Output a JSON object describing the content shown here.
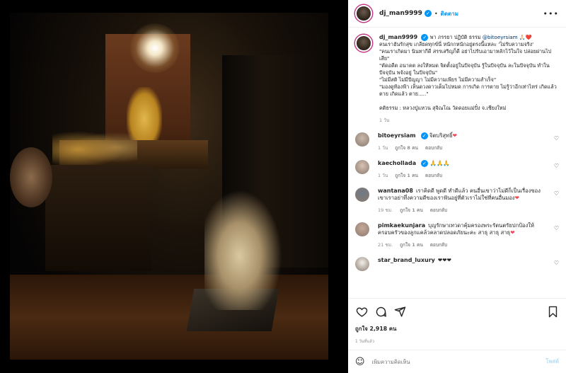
{
  "header": {
    "username": "dj_man9999",
    "separator": "•",
    "follow_label": "ติดตาม",
    "more_icon": "more-horizontal-icon"
  },
  "caption": {
    "username": "dj_man9999",
    "mention_prefix": "พา ภรรยา ปฏิบัติ ธรรม ",
    "mention": "@bitoeyrsiam",
    "mention_suffix": " 🙏🏻❤️",
    "text": "คนเราฮันรักสุข เกลียดทุกข์นี่ หนักกหนักอยู่ตรงนี้แหละ 'ไม่รับความจริง'\n\"คนเราเกิดมา นินทากีดี สรรเสริญก็ดี อย่าไปรับเอามาหลักไว้ในใจ ปล่อยผ่านไปเสีย\"\n\"ตัดอดีต อนาคต ลงให้หมด จิตตั้งอยู่ในปัจจุบัน รู้ในปัจจุบัน ละในปัจจุบัน ทำในปัจจุบัน พจังอยู่ ในปัจจุบัน\"\n\"ไม่มีสติ ไม่มีปัญญา ไม่มีความเพียร ไม่มีความสำเร็จ\"\n\"มองดูท้องฟ้า เห็นดวงดาวเต็มไปหมด การเกิด การตาย ไม่รู้ว่าอีกเท่าไหร่ เกิดแล้วตาย เกิดแล้ว ตาย.....\"\n\nคติธรรม : หลวงปู่แหวน สุจิณโณ วัดดอยแม่ปั๋ง จ.เชียงใหม่",
    "time": "1 วัน"
  },
  "comments": [
    {
      "username": "bitoeyrsiam",
      "verified": true,
      "text": "จิตบริสุทธิ์",
      "heart": true,
      "time": "1 วัน",
      "likes": "ถูกใจ 8 คน",
      "reply": "ตอบกลับ",
      "avatar_color": "#c9b7a8"
    },
    {
      "username": "kaechollada",
      "verified": true,
      "text": "🙏🙏🙏",
      "heart": false,
      "time": "1 วัน",
      "likes": "ถูกใจ 1 คน",
      "reply": "ตอบกลับ",
      "avatar_color": "#d8c3b3"
    },
    {
      "username": "wantana08",
      "verified": false,
      "text": "เราคิดดี พูดดี ทำดีแล้ว คนอื่นเขาว่าไม่ดีก็เป็นเรื่องของเขาเราอย่าทึ่งความดีของเราฟันอยู่ที่ตัวเราไม่ใช่ที่คนอื่นมอง",
      "heart": true,
      "time": "19 ชม.",
      "likes": "ถูกใจ 1 คน",
      "reply": "ตอบกลับ",
      "avatar_color": "#6f7a85"
    },
    {
      "username": "pimkaekunjara",
      "verified": false,
      "text": "บุญรักษาเทวดาคุ้มครองพระรัตนตรัยปกป้องให้ครอบครัวของลูกแคล้วคลาดปลอดภัยนะคะ สาธุ สาธุ สาธุ",
      "heart": true,
      "time": "21 ชม.",
      "likes": "ถูกใจ 1 คน",
      "reply": "ตอบกลับ",
      "avatar_color": "#c8a898"
    },
    {
      "username": "star_brand_luxury",
      "verified": false,
      "text": "❤❤❤",
      "heart": false,
      "time": "",
      "likes": "",
      "reply": "",
      "avatar_color": "#f2efe8"
    }
  ],
  "actions": {
    "likes_count": "ถูกใจ 2,918 คน",
    "time_ago": "1 วันที่แล้ว"
  },
  "add_comment": {
    "placeholder": "เพิ่มความคิดเห็น",
    "post_label": "โพสต์"
  },
  "colors": {
    "accent": "#0095f6",
    "heart": "#ed4956",
    "muted": "#8e8e8e"
  }
}
